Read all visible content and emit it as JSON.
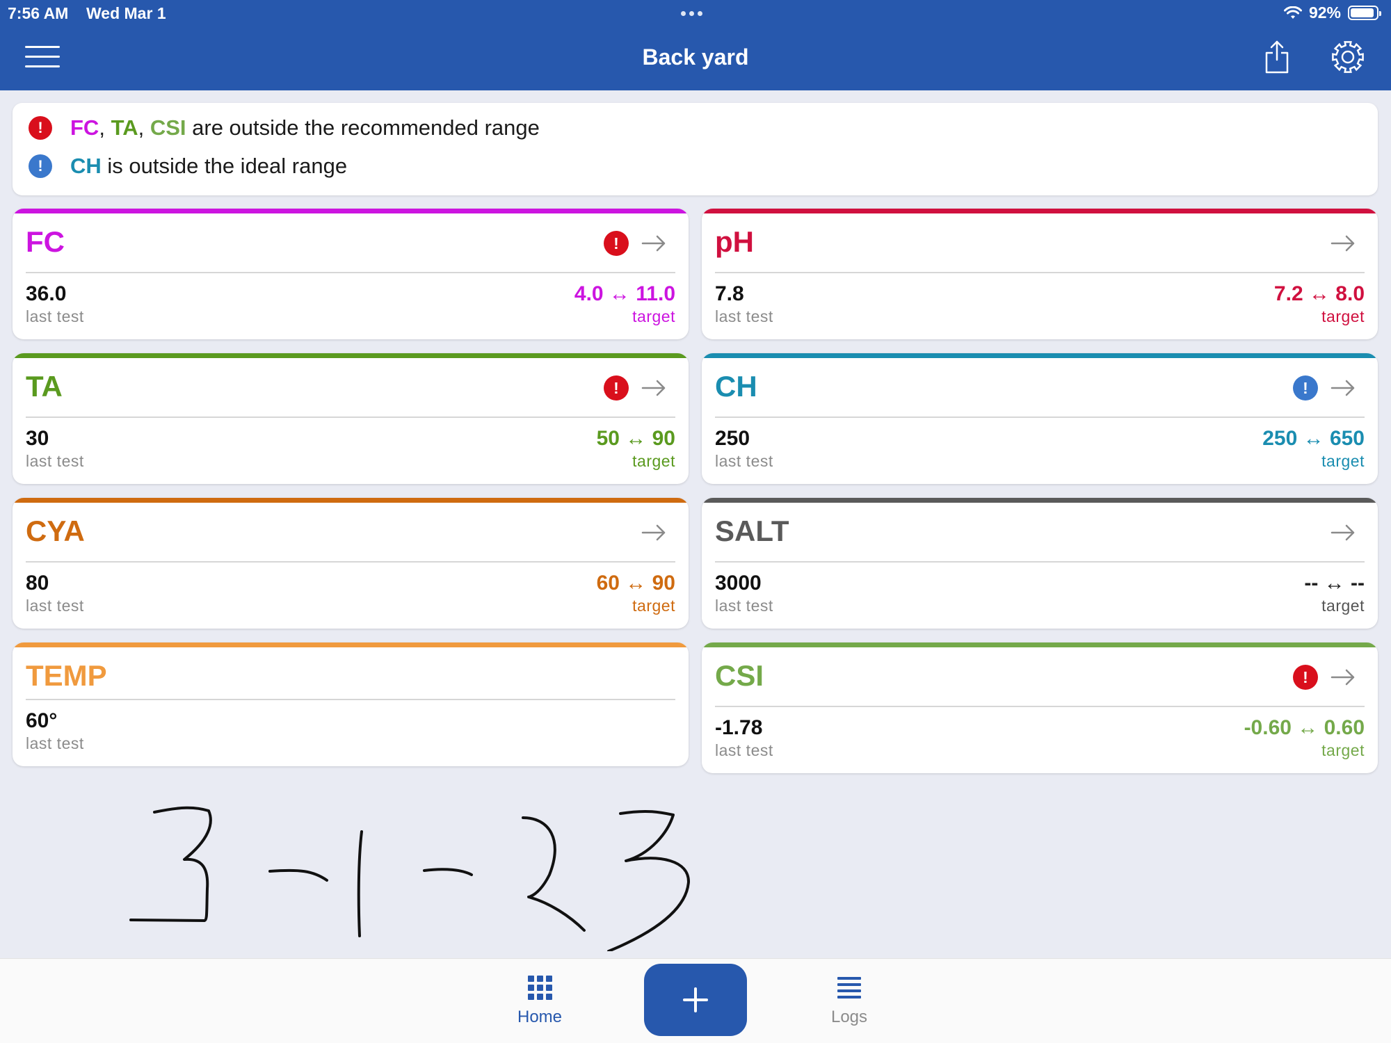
{
  "status_bar": {
    "time": "7:56 AM",
    "date": "Wed Mar 1",
    "battery": "92%",
    "battery_level": 0.92
  },
  "header": {
    "title": "Back yard",
    "menu_icon": "hamburger-menu-icon",
    "share_icon": "share-icon",
    "settings_icon": "gear-icon",
    "color": "#2758ad"
  },
  "alerts": [
    {
      "severity": "red",
      "icon": "exclamation-circle-icon",
      "items": [
        {
          "label": "FC",
          "color": "#cc14e0"
        },
        {
          "label": "TA",
          "color": "#5a9a1f"
        },
        {
          "label": "CSI",
          "color": "#74a94a"
        }
      ],
      "sep": ", ",
      "suffix": " are outside the recommended range"
    },
    {
      "severity": "blue",
      "icon": "info-exclamation-icon",
      "items": [
        {
          "label": "CH",
          "color": "#1a8db0"
        }
      ],
      "sep": ", ",
      "suffix": " is outside the ideal range"
    }
  ],
  "cards": [
    {
      "id": "fc",
      "name": "FC",
      "color": "#cc14e0",
      "value": "36.0",
      "value_label": "last test",
      "target": "4.0 ↔ 11.0",
      "target_label": "target",
      "badge": "red",
      "arrow": true,
      "target_color": "#cc14e0"
    },
    {
      "id": "ph",
      "name": "pH",
      "color": "#d0103f",
      "value": "7.8",
      "value_label": "last test",
      "target": "7.2 ↔ 8.0",
      "target_label": "target",
      "badge": null,
      "arrow": true,
      "target_color": "#d0103f"
    },
    {
      "id": "ta",
      "name": "TA",
      "color": "#5a9a1f",
      "value": "30",
      "value_label": "last test",
      "target": "50 ↔ 90",
      "target_label": "target",
      "badge": "red",
      "arrow": true,
      "target_color": "#5a9a1f"
    },
    {
      "id": "ch",
      "name": "CH",
      "color": "#1a8db0",
      "value": "250",
      "value_label": "last test",
      "target": "250 ↔ 650",
      "target_label": "target",
      "badge": "blue",
      "arrow": true,
      "target_color": "#1a8db0"
    },
    {
      "id": "cya",
      "name": "CYA",
      "color": "#cf6b10",
      "value": "80",
      "value_label": "last test",
      "target": "60 ↔ 90",
      "target_label": "target",
      "badge": null,
      "arrow": true,
      "target_color": "#cf6b10"
    },
    {
      "id": "salt",
      "name": "SALT",
      "color": "#5a5a5a",
      "value": "3000",
      "value_label": "last test",
      "target": "-- ↔ --",
      "target_label": "target",
      "badge": null,
      "arrow": true,
      "target_color": "#5a5a5a"
    },
    {
      "id": "temp",
      "name": "TEMP",
      "color": "#f09a3e",
      "value": "60°",
      "value_label": "last test",
      "target": "",
      "target_label": "",
      "badge": null,
      "arrow": false,
      "target_color": "#f09a3e"
    },
    {
      "id": "csi",
      "name": "CSI",
      "color": "#74a94a",
      "value": "-1.78",
      "value_label": "last test",
      "target": "-0.60 ↔ 0.60",
      "target_label": "target",
      "badge": "red",
      "arrow": true,
      "target_color": "#74a94a"
    }
  ],
  "handwritten_note": "3-1-23",
  "tabbar": {
    "home": {
      "label": "Home",
      "icon": "grid-icon"
    },
    "add": {
      "icon": "plus-icon"
    },
    "logs": {
      "label": "Logs",
      "icon": "list-icon"
    }
  },
  "colors": {
    "primary": "#2758ad",
    "badge_red": "#d90f1c",
    "badge_blue": "#3a78cc",
    "background": "#e9ebf3"
  }
}
